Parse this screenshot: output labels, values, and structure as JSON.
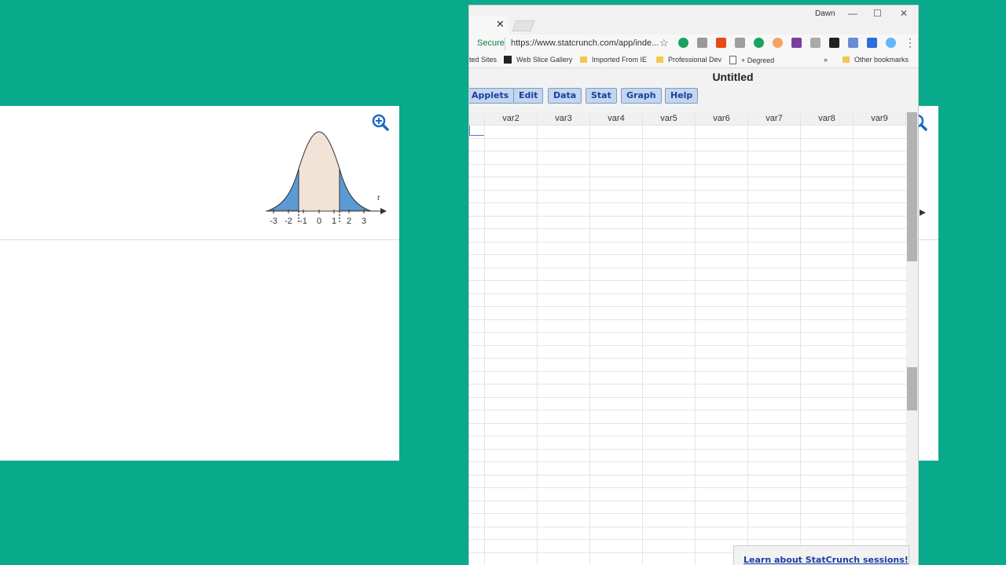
{
  "left_plot": {
    "axis_variable": "t",
    "tick_labels": [
      "-3",
      "-2",
      "-1",
      "0",
      "1",
      "2",
      "3"
    ],
    "colors": {
      "tail": "#5b9bd5",
      "center": "#f1e3d5"
    }
  },
  "browser": {
    "user": "Dawn",
    "security_label": "Secure",
    "url": "https://www.statcrunch.com/app/inde...",
    "bookmarks": {
      "item1": "ted Sites",
      "item2": "Web Slice Gallery",
      "item3": "Imported From IE",
      "item4": "Professional Dev",
      "item5": "+ Degreed",
      "overflow": "»",
      "other": "Other bookmarks"
    }
  },
  "app": {
    "title": "Untitled",
    "menu": {
      "applets": "Applets",
      "edit": "Edit",
      "data": "Data",
      "stat": "Stat",
      "graph": "Graph",
      "help": "Help"
    },
    "columns": [
      "var2",
      "var3",
      "var4",
      "var5",
      "var6",
      "var7",
      "var8",
      "var9"
    ],
    "sessions_link": "Learn about StatCrunch sessions!"
  },
  "colors": {
    "background": "#09a98b",
    "menu_button": "#c2d6ee",
    "link": "#1a3fa0"
  }
}
